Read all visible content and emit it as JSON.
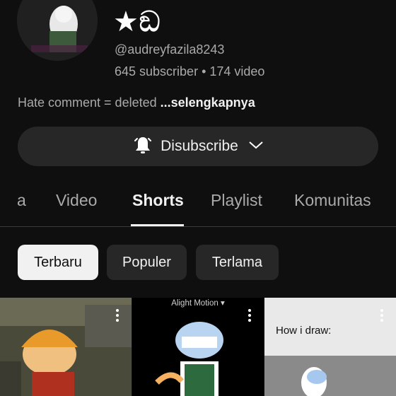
{
  "channel": {
    "name": "★ඞ",
    "handle": "@audreyfazila8243",
    "stats": "645 subscriber • 174 video",
    "description": "Hate comment = deleted",
    "more_label": "...selengkapnya"
  },
  "subscribe": {
    "label": "Disubscribe"
  },
  "tabs": [
    "a",
    "Video",
    "Shorts",
    "Playlist",
    "Komunitas"
  ],
  "active_tab": "Shorts",
  "chips": [
    "Terbaru",
    "Populer",
    "Terlama"
  ],
  "selected_chip": "Terbaru",
  "shorts": [
    {
      "watermark": ""
    },
    {
      "watermark": "Alight Motion ▾"
    },
    {
      "caption": "How i draw:"
    }
  ],
  "colors": {
    "background": "#0f0f0f",
    "chip_bg": "#272727",
    "text": "#f1f1f1",
    "muted": "#aaaaaa"
  }
}
